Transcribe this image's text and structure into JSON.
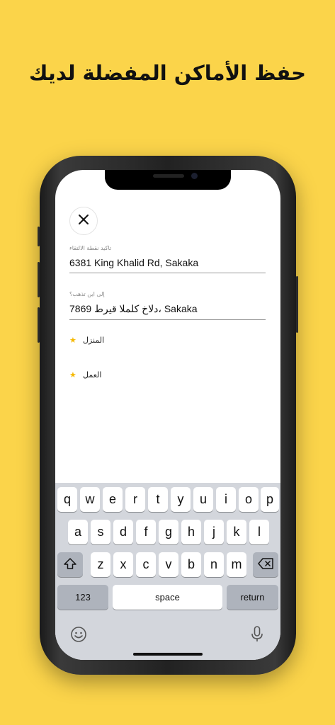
{
  "headline": "حفظ الأماكن المفضلة لديك",
  "screen": {
    "close_icon": "close-icon",
    "pickup": {
      "label": "تاكيد نقطة الالتقاء",
      "value": "6381 King Khalid Rd, Sakaka"
    },
    "destination": {
      "label": "إلى اين تذهب؟",
      "value": "7869 دلاخ كلملا قيرط، Sakaka"
    },
    "favorites": [
      {
        "label": "المنزل",
        "icon": "star-icon"
      },
      {
        "label": "العمل",
        "icon": "star-icon"
      }
    ]
  },
  "keyboard": {
    "row1": [
      "q",
      "w",
      "e",
      "r",
      "t",
      "y",
      "u",
      "i",
      "o",
      "p"
    ],
    "row2": [
      "a",
      "s",
      "d",
      "f",
      "g",
      "h",
      "j",
      "k",
      "l"
    ],
    "row3": [
      "z",
      "x",
      "c",
      "v",
      "b",
      "n",
      "m"
    ],
    "shift_icon": "shift-icon",
    "backspace_icon": "backspace-icon",
    "numbers_label": "123",
    "space_label": "space",
    "return_label": "return",
    "emoji_icon": "emoji-icon",
    "mic_icon": "microphone-icon"
  },
  "colors": {
    "background": "#FBD44A",
    "star": "#F5B800",
    "keyboard": "#D3D6DC"
  }
}
